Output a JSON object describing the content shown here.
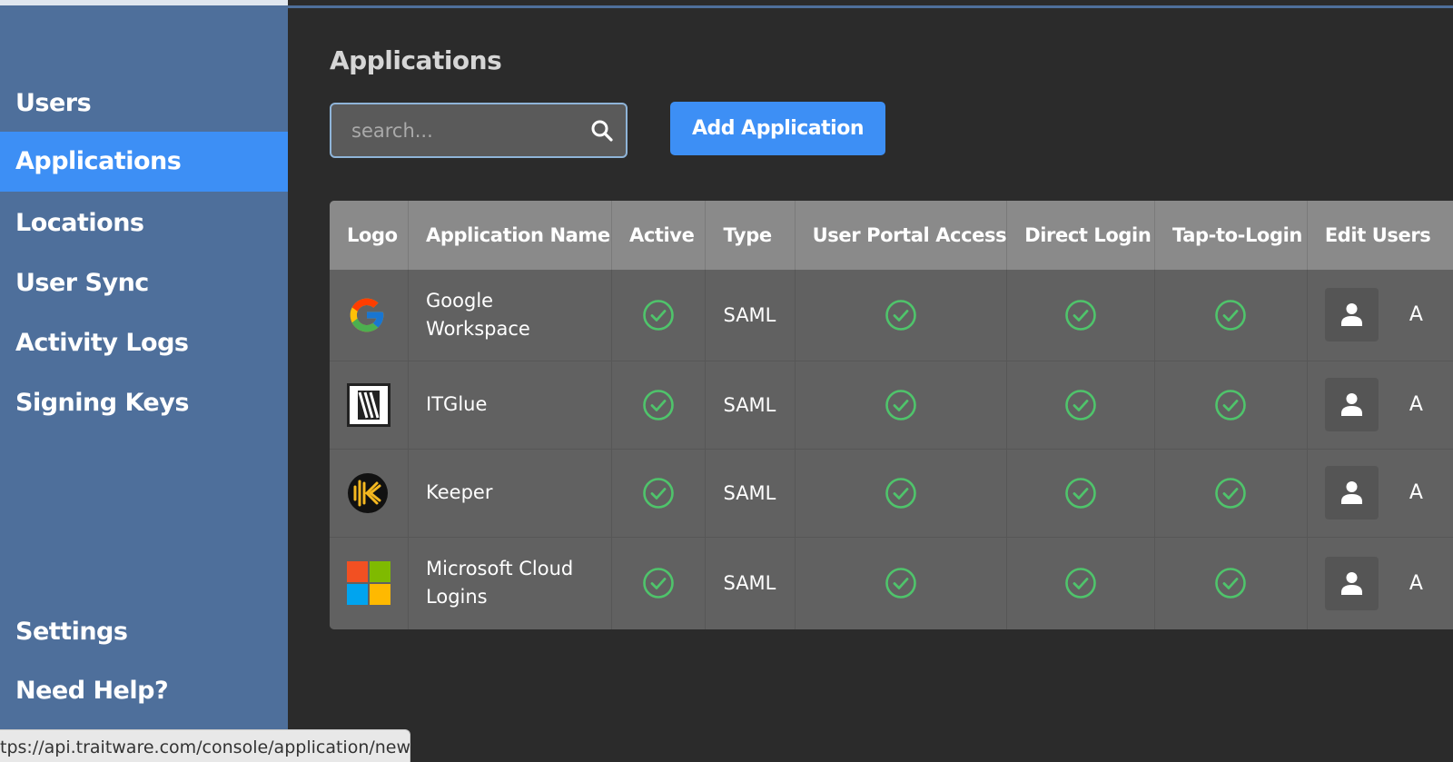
{
  "sidebar": {
    "items": [
      {
        "label": "Users"
      },
      {
        "label": "Applications",
        "active": true
      },
      {
        "label": "Locations"
      },
      {
        "label": "User Sync"
      },
      {
        "label": "Activity Logs"
      },
      {
        "label": "Signing Keys"
      }
    ],
    "bottom_items": [
      {
        "label": "Settings"
      },
      {
        "label": "Need Help?"
      }
    ]
  },
  "main": {
    "title": "Applications",
    "search": {
      "placeholder": "search...",
      "value": ""
    },
    "add_button_label": "Add Application"
  },
  "table": {
    "columns": [
      "Logo",
      "Application Name",
      "Active",
      "Type",
      "User Portal Access",
      "Direct Login",
      "Tap-to-Login",
      "Edit Users"
    ],
    "rows": [
      {
        "logo": "google-logo-icon",
        "name_line1": "Google",
        "name_line2": "Workspace",
        "active": true,
        "type": "SAML",
        "portal": true,
        "direct": true,
        "tap": true,
        "trailing": "A"
      },
      {
        "logo": "itglue-logo-icon",
        "name_line1": "ITGlue",
        "name_line2": "",
        "active": true,
        "type": "SAML",
        "portal": true,
        "direct": true,
        "tap": true,
        "trailing": "A"
      },
      {
        "logo": "keeper-logo-icon",
        "name_line1": "Keeper",
        "name_line2": "",
        "active": true,
        "type": "SAML",
        "portal": true,
        "direct": true,
        "tap": true,
        "trailing": "A"
      },
      {
        "logo": "microsoft-logo-icon",
        "name_line1": "Microsoft Cloud",
        "name_line2": "Logins",
        "active": true,
        "type": "SAML",
        "portal": true,
        "direct": true,
        "tap": true,
        "trailing": "A"
      }
    ]
  },
  "status_bar": {
    "url": "tps://api.traitware.com/console/application/new"
  },
  "colors": {
    "sidebar": "#4e6f9b",
    "accent": "#3d8ff5",
    "check": "#4fc46b",
    "background": "#2b2b2b"
  }
}
